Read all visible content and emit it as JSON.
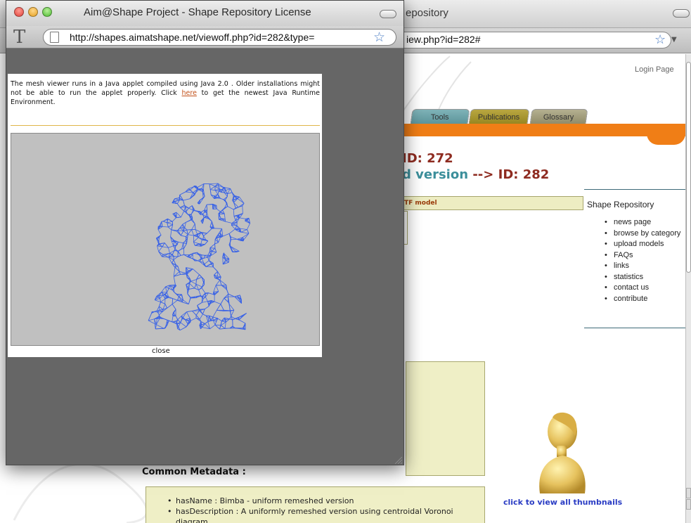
{
  "background_window": {
    "title_fragment": "epository",
    "url_fragment": "iew.php?id=282#",
    "login_link": "Login Page",
    "tabs": [
      {
        "label": "Tools",
        "color": "#6fa3a9"
      },
      {
        "label": "Publications",
        "color": "#a8962f"
      },
      {
        "label": "Glossary",
        "color": "#a29d7c"
      }
    ],
    "accent_color": "#f07e16",
    "id_line1": "ID: 272",
    "id_line2_part1": "d version",
    "id_line2_part2": "--> ID: 282",
    "model_bar_label": "TF model",
    "side_panel": {
      "title": "Shape Repository",
      "items": [
        "news page",
        "browse by category",
        "upload models",
        "FAQs",
        "links",
        "statistics",
        "contact us",
        "contribute"
      ]
    },
    "common_metadata_heading": "Common Metadata :",
    "metadata_items": [
      "hasName : Bimba - uniform remeshed version",
      "hasDescription : A uniformly remeshed version using centroidal Voronoi diagram"
    ],
    "thumbnail_link": "click to view all thumbnails"
  },
  "popup_window": {
    "title": "Aim@Shape Project - Shape Repository License",
    "url": "http://shapes.aimatshape.net/viewoff.php?id=282&type=",
    "viewer_note_before_link": "The mesh viewer runs in a Java applet compiled using Java 2.0 . Older installations might not be able to run the applet properly. Click ",
    "viewer_note_link": "here",
    "viewer_note_after_link": " to get the newest Java Runtime Environment.",
    "close_label": "close",
    "mesh_color": "#3a63e6",
    "applet_background": "#c0c0c0"
  }
}
